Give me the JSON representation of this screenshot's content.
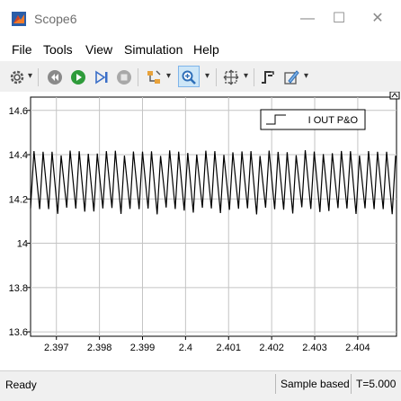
{
  "window": {
    "title": "Scope6",
    "minimize_glyph": "—",
    "maximize_glyph": "☐",
    "close_glyph": "✕",
    "icon": "matlab-icon"
  },
  "menu": {
    "items": [
      "File",
      "Tools",
      "View",
      "Simulation",
      "Help"
    ]
  },
  "toolbar": {
    "icons": [
      "gear-icon",
      "step-back-icon",
      "run-icon",
      "step-forward-icon",
      "stop-icon",
      "highlight-icon",
      "zoom-icon",
      "autoscale-icon",
      "triggers-icon",
      "style-icon"
    ],
    "dropdown_glyph": "▾"
  },
  "plot": {
    "legend": "I OUT P&O",
    "background": "#ffffff",
    "line_color": "#000000"
  },
  "chart_data": {
    "type": "line",
    "title": "",
    "xlabel": "",
    "ylabel": "",
    "xlim": [
      2.3964,
      2.4049
    ],
    "ylim": [
      13.58,
      14.66
    ],
    "xticks": [
      2.397,
      2.398,
      2.399,
      2.4,
      2.401,
      2.402,
      2.403,
      2.404
    ],
    "xtick_labels": [
      "2.397",
      "2.398",
      "2.399",
      "2.4",
      "2.401",
      "2.402",
      "2.403",
      "2.404"
    ],
    "yticks": [
      13.6,
      13.8,
      14,
      14.2,
      14.4,
      14.6
    ],
    "ytick_labels": [
      "13.6",
      "13.8",
      "14",
      "14.2",
      "14.4",
      "14.6"
    ],
    "grid": true,
    "legend_position": "top-right",
    "series": [
      {
        "name": "I OUT P&O",
        "signal": "sawtooth",
        "period": 0.00021,
        "peak": 14.41,
        "trough": 14.15
      }
    ]
  },
  "status": {
    "ready": "Ready",
    "mode": "Sample based",
    "time": "T=5.000"
  }
}
